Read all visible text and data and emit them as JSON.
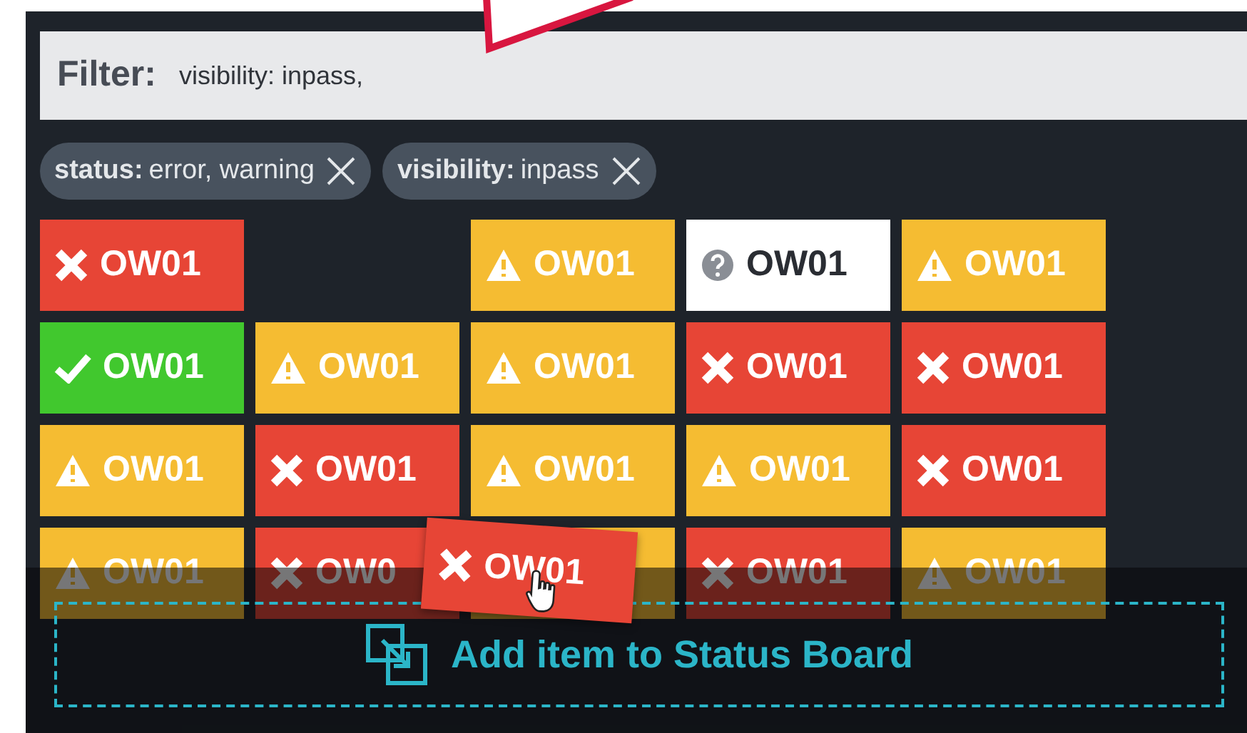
{
  "filter": {
    "label": "Filter:",
    "value": "visibility: inpass,"
  },
  "chips": [
    {
      "key": "status:",
      "value": "error, warning"
    },
    {
      "key": "visibility:",
      "value": "inpass"
    }
  ],
  "tiles": [
    [
      {
        "kind": "error",
        "label": "OW01"
      },
      {
        "kind": "empty"
      },
      {
        "kind": "warning",
        "label": "OW01"
      },
      {
        "kind": "unknown",
        "label": "OW01"
      },
      {
        "kind": "warning",
        "label": "OW01"
      }
    ],
    [
      {
        "kind": "ok",
        "label": "OW01"
      },
      {
        "kind": "warning",
        "label": "OW01"
      },
      {
        "kind": "warning",
        "label": "OW01"
      },
      {
        "kind": "error",
        "label": "OW01"
      },
      {
        "kind": "error",
        "label": "OW01"
      }
    ],
    [
      {
        "kind": "warning",
        "label": "OW01"
      },
      {
        "kind": "error",
        "label": "OW01"
      },
      {
        "kind": "warning",
        "label": "OW01"
      },
      {
        "kind": "warning",
        "label": "OW01"
      },
      {
        "kind": "error",
        "label": "OW01"
      }
    ],
    [
      {
        "kind": "warning",
        "label": "OW01"
      },
      {
        "kind": "error",
        "label": "OW0"
      },
      {
        "kind": "warning"
      },
      {
        "kind": "error",
        "label": "OW01"
      },
      {
        "kind": "warning",
        "label": "OW01"
      }
    ]
  ],
  "drag": {
    "kind": "error",
    "label": "OW01"
  },
  "drop_zone": {
    "label": "Add item to Status Board"
  }
}
